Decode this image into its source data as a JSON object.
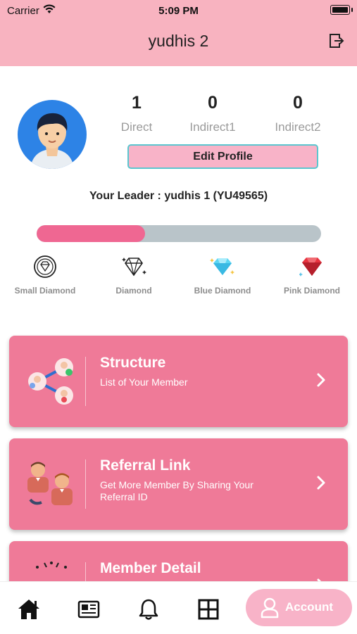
{
  "status_bar": {
    "carrier": "Carrier",
    "time": "5:09 PM"
  },
  "header": {
    "title": "yudhis 2",
    "logout_icon": "logout-icon"
  },
  "profile": {
    "avatar_icon": "user-avatar",
    "stats": [
      {
        "value": "1",
        "label": "Direct"
      },
      {
        "value": "0",
        "label": "Indirect1"
      },
      {
        "value": "0",
        "label": "Indirect2"
      }
    ],
    "edit_label": "Edit Profile",
    "leader_text": "Your Leader : yudhis 1 (YU49565)"
  },
  "progress": {
    "fraction": 0.38,
    "bar_color": "#ef6792",
    "track_color": "#b9c4c9"
  },
  "ranks": [
    {
      "label": "Small Diamond",
      "icon": "small-diamond-icon"
    },
    {
      "label": "Diamond",
      "icon": "diamond-icon"
    },
    {
      "label": "Blue Diamond",
      "icon": "blue-diamond-icon"
    },
    {
      "label": "Pink Diamond",
      "icon": "pink-diamond-icon"
    }
  ],
  "menu": [
    {
      "title": "Structure",
      "subtitle": "List of Your Member"
    },
    {
      "title": "Referral Link",
      "subtitle": "Get More Member By Sharing Your Referral ID"
    },
    {
      "title": "Member Detail",
      "subtitle": ""
    }
  ],
  "bottom_nav": {
    "items": [
      "home-icon",
      "news-icon",
      "bell-icon",
      "grid-icon"
    ],
    "active_label": "Account"
  },
  "colors": {
    "header_bg": "#f8b3c0",
    "card_bg": "#ef7a98",
    "accent_pink": "#ef6792",
    "edit_border": "#5bc6cf"
  }
}
